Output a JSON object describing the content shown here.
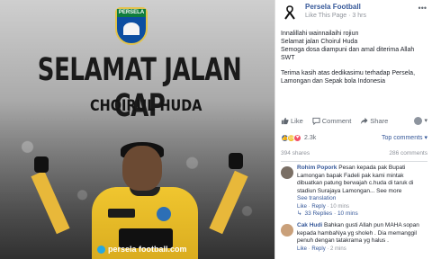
{
  "photo": {
    "logo_text": "PERSELA",
    "headline": "SELAMAT JALAN CAP",
    "subheadline": "CHOIRUL HUDA",
    "website": "persela football.com"
  },
  "post": {
    "page_name": "Persela Football",
    "page_meta": "Like This Page · 3 hrs",
    "lines": [
      "Innalillahi wainnailaihi rojiun",
      "Selamat jalan Choirul Huda",
      "Semoga dosa diampuni dan amal diterima Allah SWT",
      "Terima kasih atas dedikasimu terhadap Persela, Lamongan dan Sepak bola Indonesia"
    ]
  },
  "actions": {
    "like": "Like",
    "comment": "Comment",
    "share": "Share"
  },
  "reactions": {
    "count": "2.3k",
    "top_comments": "Top comments ▾"
  },
  "stats": {
    "shares": "394 shares",
    "comments": "286 comments"
  },
  "comments": [
    {
      "name": "Rohim Popork",
      "text": "Pesan kepada pak Bupati Lamongan bapak Fadeli pak kami mintak dibuatkan patung berwajah c.huda di taruk di stadiun Surajaya Lamongan... See more",
      "translation_link": "See translation",
      "meta_like": "Like",
      "meta_reply": "Reply",
      "meta_time": "10 mins",
      "replies": "33 Replies · 10 mins"
    },
    {
      "name": "Cak Hudi",
      "text": "Bahkan gusti Allah pun MAHA sopan kepada hambaNya yg sholeh . Dia memanggil penuh dengan tatakrama yg halus .",
      "meta_like": "Like",
      "meta_reply": "Reply",
      "meta_time": "2 mins"
    }
  ],
  "colors": {
    "link": "#365899",
    "accent_blue": "#4267b2",
    "jersey": "#f0c62f"
  }
}
